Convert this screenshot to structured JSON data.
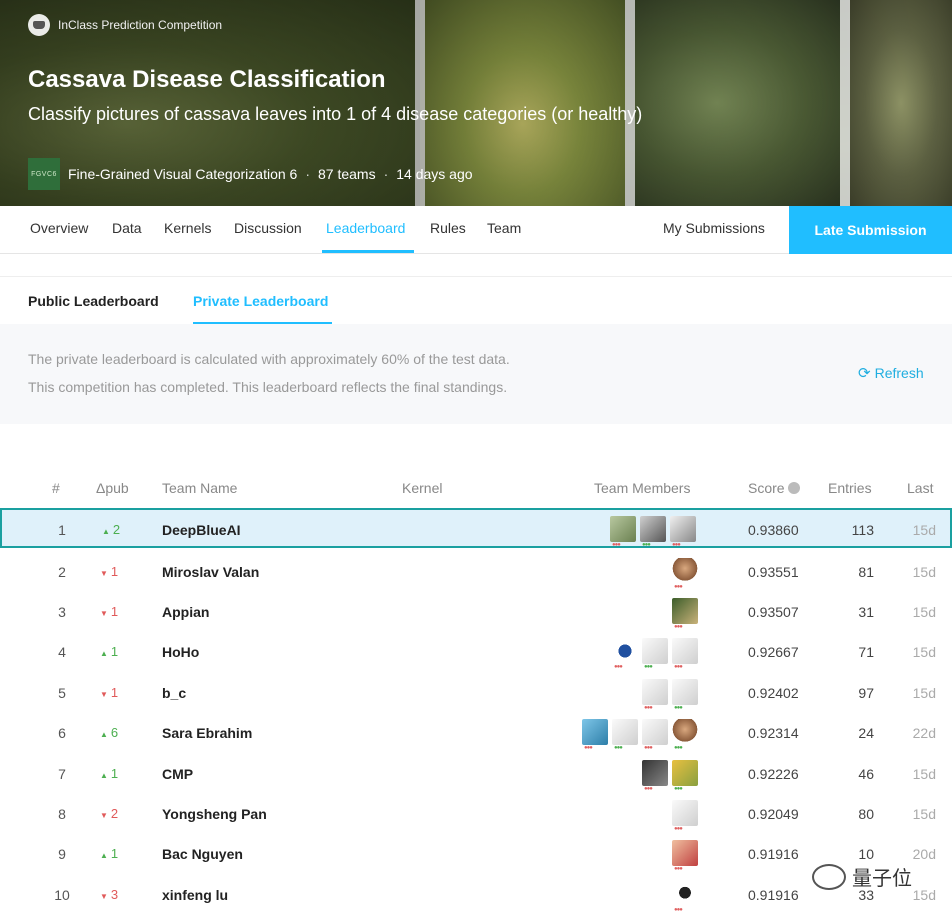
{
  "header": {
    "badge": "InClass Prediction Competition",
    "title": "Cassava Disease Classification",
    "subtitle": "Classify pictures of cassava leaves into 1 of 4 disease categories (or healthy)",
    "logo_text": "FGVC6",
    "host": "Fine-Grained Visual Categorization 6",
    "teams": "87 teams",
    "time": "14 days ago"
  },
  "nav": {
    "items": [
      "Overview",
      "Data",
      "Kernels",
      "Discussion",
      "Leaderboard",
      "Rules",
      "Team"
    ],
    "active": "Leaderboard",
    "my_submissions": "My Submissions",
    "late_submission": "Late Submission"
  },
  "leaderboard_tabs": {
    "public": "Public Leaderboard",
    "private": "Private Leaderboard",
    "active": "Private Leaderboard"
  },
  "info": {
    "line1": "The private leaderboard is calculated with approximately 60% of the test data.",
    "line2": "This competition has completed. This leaderboard reflects the final standings.",
    "refresh": "Refresh"
  },
  "table": {
    "headers": {
      "rank": "#",
      "delta": "Δpub",
      "team": "Team Name",
      "kernel": "Kernel",
      "members": "Team Members",
      "score": "Score",
      "entries": "Entries",
      "last": "Last"
    },
    "rows": [
      {
        "rank": "1",
        "dir": "up",
        "delta": "2",
        "team": "DeepBlueAI",
        "score": "0.93860",
        "entries": "113",
        "last": "15d",
        "avatars": [
          "a-photo1",
          "a-photo2",
          "a-photo3"
        ]
      },
      {
        "rank": "2",
        "dir": "down",
        "delta": "1",
        "team": "Miroslav Valan",
        "score": "0.93551",
        "entries": "81",
        "last": "15d",
        "avatars": [
          "a-man"
        ]
      },
      {
        "rank": "3",
        "dir": "down",
        "delta": "1",
        "team": "Appian",
        "score": "0.93507",
        "entries": "31",
        "last": "15d",
        "avatars": [
          "a-bird"
        ]
      },
      {
        "rank": "4",
        "dir": "up",
        "delta": "1",
        "team": "HoHo",
        "score": "0.92667",
        "entries": "71",
        "last": "15d",
        "avatars": [
          "a-blue",
          "a-hand",
          "a-hand"
        ]
      },
      {
        "rank": "5",
        "dir": "down",
        "delta": "1",
        "team": "b_c",
        "score": "0.92402",
        "entries": "97",
        "last": "15d",
        "avatars": [
          "a-hand",
          "a-hand"
        ]
      },
      {
        "rank": "6",
        "dir": "up",
        "delta": "6",
        "team": "Sara Ebrahim",
        "score": "0.92314",
        "entries": "24",
        "last": "22d",
        "avatars": [
          "a-sea",
          "a-hand",
          "a-hand",
          "a-man"
        ]
      },
      {
        "rank": "7",
        "dir": "up",
        "delta": "1",
        "team": "CMP",
        "score": "0.92226",
        "entries": "46",
        "last": "15d",
        "avatars": [
          "a-dark",
          "a-yellow"
        ]
      },
      {
        "rank": "8",
        "dir": "down",
        "delta": "2",
        "team": "Yongsheng Pan",
        "score": "0.92049",
        "entries": "80",
        "last": "15d",
        "avatars": [
          "a-hand"
        ]
      },
      {
        "rank": "9",
        "dir": "up",
        "delta": "1",
        "team": "Bac Nguyen",
        "score": "0.91916",
        "entries": "10",
        "last": "20d",
        "avatars": [
          "a-cartoon"
        ]
      },
      {
        "rank": "10",
        "dir": "down",
        "delta": "3",
        "team": "xinfeng lu",
        "score": "0.91916",
        "entries": "33",
        "last": "15d",
        "avatars": [
          "a-small"
        ]
      }
    ]
  },
  "watermark": "量子位",
  "colors": {
    "accent": "#20beff",
    "up": "#4caf50",
    "down": "#e05a5a",
    "highlight_border": "#1aa0a0"
  }
}
